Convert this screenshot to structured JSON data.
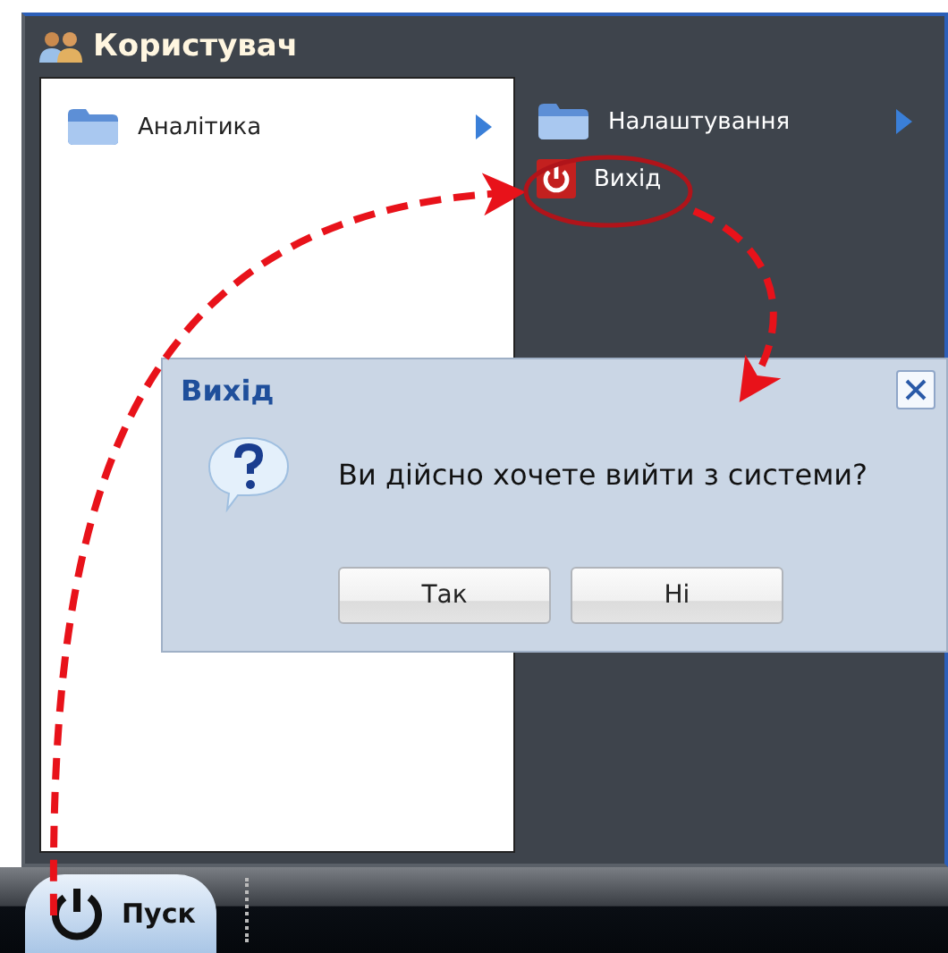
{
  "window": {
    "title": "Користувач"
  },
  "menu_left": [
    {
      "label": "Аналітика",
      "kind": "folder",
      "has_submenu": true
    }
  ],
  "menu_right": [
    {
      "label": "Налаштування",
      "kind": "folder",
      "has_submenu": true
    },
    {
      "label": "Вихід",
      "kind": "power",
      "has_submenu": false
    }
  ],
  "dialog": {
    "title": "Вихід",
    "message": "Ви дійсно хочете вийти з системи?",
    "buttons": [
      "Так",
      "Ні"
    ]
  },
  "taskbar": {
    "start_label": "Пуск"
  }
}
